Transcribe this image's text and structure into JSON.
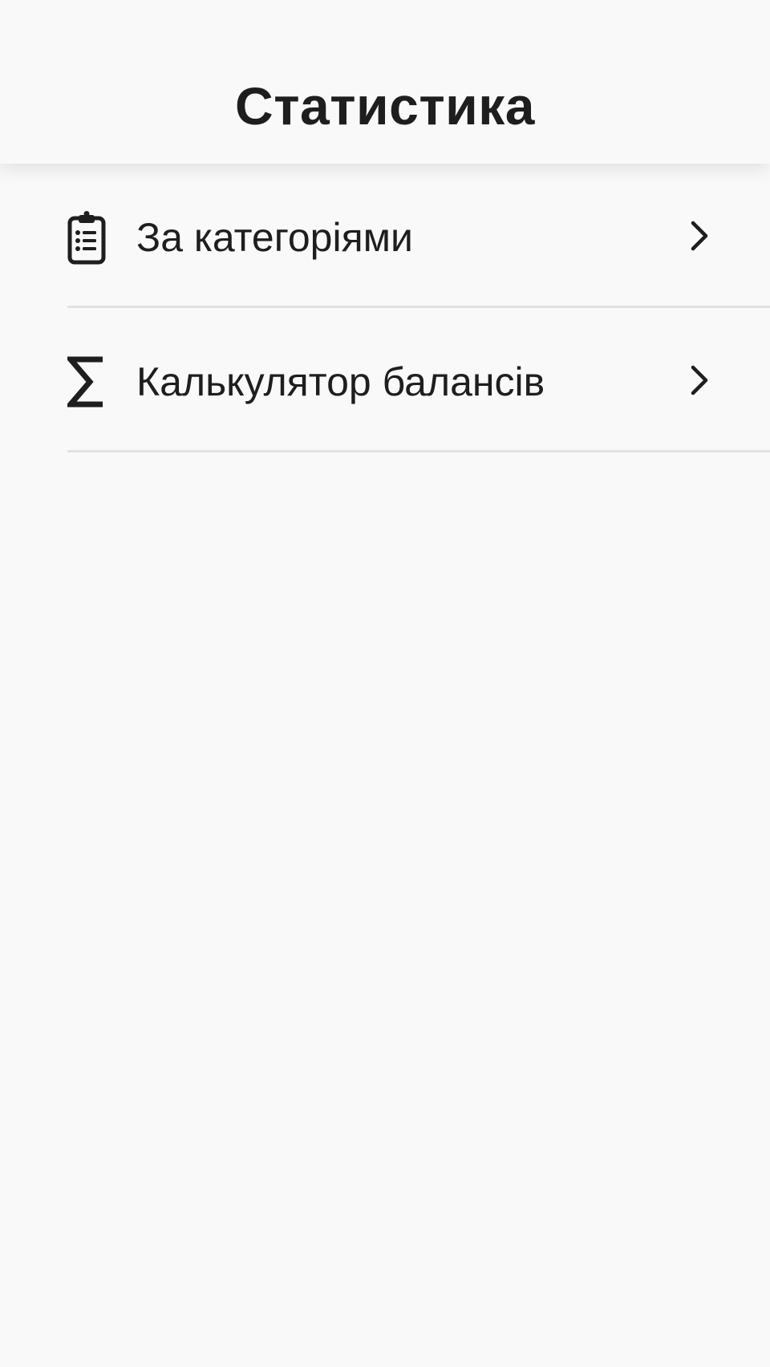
{
  "header": {
    "title": "Статистика"
  },
  "menu": {
    "items": [
      {
        "label": "За категоріями",
        "icon": "clipboard-list-icon"
      },
      {
        "label": "Калькулятор балансів",
        "icon": "sigma-icon"
      }
    ]
  },
  "colors": {
    "background": "#f9f9f9",
    "text": "#1e1e1e",
    "divider": "#e2e2e2"
  }
}
